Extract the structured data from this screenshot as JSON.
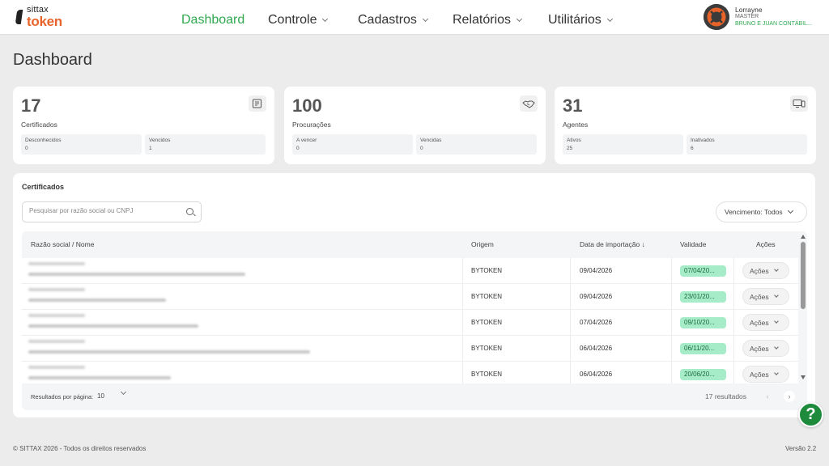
{
  "brand": {
    "top": "sittax",
    "bottom": "token"
  },
  "nav": [
    {
      "label": "Dashboard",
      "active": true,
      "dropdown": false
    },
    {
      "label": "Controle",
      "active": false,
      "dropdown": true
    },
    {
      "label": "Cadastros",
      "active": false,
      "dropdown": true
    },
    {
      "label": "Relatórios",
      "active": false,
      "dropdown": true
    },
    {
      "label": "Utilitários",
      "active": false,
      "dropdown": true
    }
  ],
  "user": {
    "name": "Lorrayne",
    "role": "MASTER",
    "company": "BRUNO E JUAN CONTÁBIL..."
  },
  "page_title": "Dashboard",
  "stats": [
    {
      "number": "17",
      "label": "Certificados",
      "icon": "certificate-icon",
      "subs": [
        {
          "label": "Desconhecidos",
          "value": "0"
        },
        {
          "label": "Vencidos",
          "value": "1"
        }
      ]
    },
    {
      "number": "100",
      "label": "Procurações",
      "icon": "handshake-icon",
      "subs": [
        {
          "label": "A vencer",
          "value": "0"
        },
        {
          "label": "Vencidas",
          "value": "0"
        }
      ]
    },
    {
      "number": "31",
      "label": "Agentes",
      "icon": "devices-icon",
      "subs": [
        {
          "label": "Ativos",
          "value": "25"
        },
        {
          "label": "Inativados",
          "value": "6"
        }
      ]
    }
  ],
  "certificados": {
    "title": "Certificados",
    "search_placeholder": "Pesquisar por razão social ou CNPJ",
    "filter_label": "Vencimento: Todos",
    "columns": {
      "name": "Razão social / Nome",
      "origin": "Origem",
      "import_date": "Data de importação ↓",
      "validity": "Validade",
      "actions": "Ações"
    },
    "rows": [
      {
        "origin": "BYTOKEN",
        "import_date": "09/04/2026",
        "validity": "07/04/20...",
        "action": "Ações"
      },
      {
        "origin": "BYTOKEN",
        "import_date": "09/04/2026",
        "validity": "23/01/20...",
        "action": "Ações"
      },
      {
        "origin": "BYTOKEN",
        "import_date": "07/04/2026",
        "validity": "09/10/20...",
        "action": "Ações"
      },
      {
        "origin": "BYTOKEN",
        "import_date": "06/04/2026",
        "validity": "06/11/20...",
        "action": "Ações"
      },
      {
        "origin": "BYTOKEN",
        "import_date": "06/04/2026",
        "validity": "20/06/20...",
        "action": "Ações"
      }
    ],
    "per_page_label": "Resultados por página:",
    "per_page_value": "10",
    "results_text": "17 resultados"
  },
  "help_label": "?",
  "footer": {
    "copyright": "© SITTAX 2026 - Todos os direitos reservados",
    "version": "Versão 2.2"
  },
  "colors": {
    "accent_green": "#2fa84f",
    "brand_orange": "#e8632a",
    "badge_green": "#a7ecc9",
    "help_green": "#1e8a3c"
  }
}
